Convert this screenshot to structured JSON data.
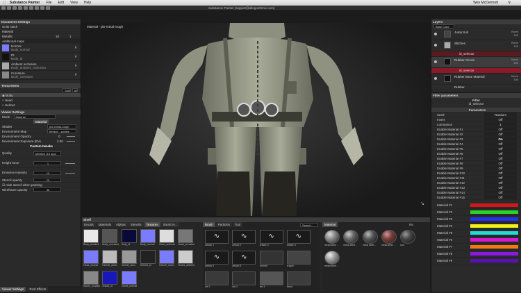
{
  "menubar": {
    "app": "Substance Painter",
    "items": [
      "File",
      "Edit",
      "View",
      "Help"
    ],
    "title": "Substance Painter [support@allegorithmic.com]",
    "user": "Wes McDermott",
    "clock": "Q"
  },
  "doc_settings": {
    "title": "Document Settings",
    "units": "Units stack",
    "channels_label": "Material",
    "metallic_label": "Metallic",
    "metallic_value": "18",
    "metallic_num": "1",
    "additional_maps": "Additional maps",
    "maps": [
      {
        "name": "Normal",
        "file": "Body_normal",
        "color": "#7b7bff"
      },
      {
        "name": "ID",
        "file": "Body_id",
        "color": "#111"
      },
      {
        "name": "Ambient occlusion",
        "file": "Body_ambient_occlusion",
        "color": "#aaa"
      },
      {
        "name": "Curvature",
        "file": "Body_curvature",
        "color": "#888"
      }
    ]
  },
  "texture_sets": {
    "title": "TextureSets",
    "solo": "Solo",
    "all": "All",
    "items": [
      "Body",
      "Head",
      "Helmet"
    ]
  },
  "viewer_settings": {
    "title": "Viewer Settings",
    "mode_label": "Mode",
    "mode_value": "Material",
    "material_tab": "Material",
    "shader_label": "Shader",
    "shader_value": "pbr-metal-rough",
    "envmap_label": "Environment Map",
    "envmap_value": "terrace_..ponies",
    "envopacity_label": "Environment Opacity",
    "envopacity_value": "0",
    "envexposure_label": "Environment Exposure (EV)",
    "envexposure_value": "2.00",
    "custom_tweaks": "Custom tweaks",
    "quality_label": "Quality",
    "quality_value": "Medium (16 spp)",
    "height_label": "Height force",
    "height_value": "1",
    "emissive_label": "Emissive intensity",
    "emissive_value": "10",
    "stencil_label": "Stencil opacity",
    "stencil_value": "25",
    "hide_stencil": "Hide stencil when painting",
    "wire_label": "Wireframe opacity",
    "wire_value": "36",
    "bottom_tabs": [
      "Viewer Settings",
      "Post Effects"
    ]
  },
  "viewport": {
    "label": "Material - pbr-metal-rough"
  },
  "layers": {
    "title": "Layers",
    "base_color": "Base Color",
    "items": [
      {
        "name": "Jump Suit",
        "mode": "Norm",
        "opacity": "100"
      },
      {
        "name": "Stitches",
        "mode": "Norm",
        "opacity": "100"
      },
      {
        "name": "id_selector",
        "mode": "",
        "opacity": ""
      },
      {
        "name": "Rubber Circuit",
        "mode": "Norm",
        "opacity": "100"
      },
      {
        "name": "id_selector",
        "mode": "",
        "opacity": ""
      },
      {
        "name": "Rubber Base Material",
        "mode": "Norm",
        "opacity": "100"
      },
      {
        "name": "Rubber",
        "mode": "",
        "opacity": ""
      }
    ]
  },
  "filter_params": {
    "title": "Filter parameters",
    "filter_name": "Filter",
    "filter_sub": "id_selector",
    "section": "Parameters",
    "params": [
      {
        "label": "Seed",
        "value": "Random"
      },
      {
        "label": "Invert",
        "value": "Off"
      },
      {
        "label": "Luminance",
        "value": "1"
      },
      {
        "label": "Enable Material #1",
        "value": "Off"
      },
      {
        "label": "Enable Material #2",
        "value": "Off"
      },
      {
        "label": "Enable Material #3",
        "value": "On"
      },
      {
        "label": "Enable Material #4",
        "value": "Off"
      },
      {
        "label": "Enable Material #5",
        "value": "Off"
      },
      {
        "label": "Enable Material #6",
        "value": "Off"
      },
      {
        "label": "Enable Material #7",
        "value": "Off"
      },
      {
        "label": "Enable Material #8",
        "value": "Off"
      },
      {
        "label": "Enable Material #9",
        "value": "Off"
      },
      {
        "label": "Enable Material #10",
        "value": "Off"
      },
      {
        "label": "Enable Material #11",
        "value": "Off"
      },
      {
        "label": "Enable Material #12",
        "value": "Off"
      },
      {
        "label": "Enable Material #13",
        "value": "Off"
      },
      {
        "label": "Enable Material #14",
        "value": "Off"
      },
      {
        "label": "Enable Material #15",
        "value": "Off"
      }
    ],
    "materials": [
      {
        "label": "Material #1",
        "color": "#d01818"
      },
      {
        "label": "Material #2",
        "color": "#2ad12a"
      },
      {
        "label": "Material #3",
        "color": "#2233ee"
      },
      {
        "label": "Material #4",
        "color": "#f2f21a"
      },
      {
        "label": "Material #5",
        "color": "#22d8d8"
      },
      {
        "label": "Material #6",
        "color": "#d21ad2"
      },
      {
        "label": "Material #7",
        "color": "#f27a12"
      },
      {
        "label": "Material #8",
        "color": "#8a1ae0"
      },
      {
        "label": "Material #9",
        "color": "#5a10b8"
      }
    ]
  },
  "shelf": {
    "title": "Shelf",
    "tabs": [
      "Decals",
      "Materials",
      "Alphas",
      "Stencils",
      "Textures",
      "Smart m..."
    ],
    "search": "Search...",
    "textures": [
      {
        "cap": "Body_ambient",
        "color": "#e8e8e8"
      },
      {
        "cap": "Body_curvature",
        "color": "#555"
      },
      {
        "cap": "Body_id",
        "color": "#0a0a3a"
      },
      {
        "cap": "Body_normal",
        "color": "#7b7bff"
      },
      {
        "cap": "Head_ambient",
        "color": "#ddd"
      },
      {
        "cap": "Head_curvature",
        "color": "#777"
      },
      {
        "cap": "Head_normal",
        "color": "#7b7bff"
      },
      {
        "cap": "Helmet_ambi..",
        "color": "#bbb"
      },
      {
        "cap": "Helmet_curv..",
        "color": "#999"
      },
      {
        "cap": "Helmet_id",
        "color": "#222"
      },
      {
        "cap": "Helmet_norm..",
        "color": "#7b7bff"
      },
      {
        "cap": "Shoes_ambient",
        "color": "#ccc"
      },
      {
        "cap": "Shoes_curvature",
        "color": "#888"
      },
      {
        "cap": "Shoes_id",
        "color": "#1818b8"
      },
      {
        "cap": "Shoes_normal",
        "color": "#7b7bff"
      }
    ],
    "brush_tabs": [
      "Brush",
      "Particles",
      "Tool"
    ],
    "brushes": [
      "artistic 1",
      "artistic 2",
      "artistic 3",
      "artistic 4",
      "artistic 5",
      "artistic 6",
      "cement",
      "crayon",
      "dirt 1",
      "dirt 2",
      "dirt 3",
      "fibers",
      "basic hard",
      "bark",
      "blobs",
      "dirt 4"
    ],
    "material_tab": "Material",
    "material_num": "No",
    "materials": [
      {
        "cap": "metal steel ..",
        "color": "#888"
      },
      {
        "cap": "metal steel ..",
        "color": "#666"
      },
      {
        "cap": "metal steel ..",
        "color": "#555"
      },
      {
        "cap": "metal steel ..",
        "color": "#7a3a3a"
      },
      {
        "cap": "rust",
        "color": "#444"
      },
      {
        "cap": "metal steel ..",
        "color": "#999"
      }
    ]
  }
}
